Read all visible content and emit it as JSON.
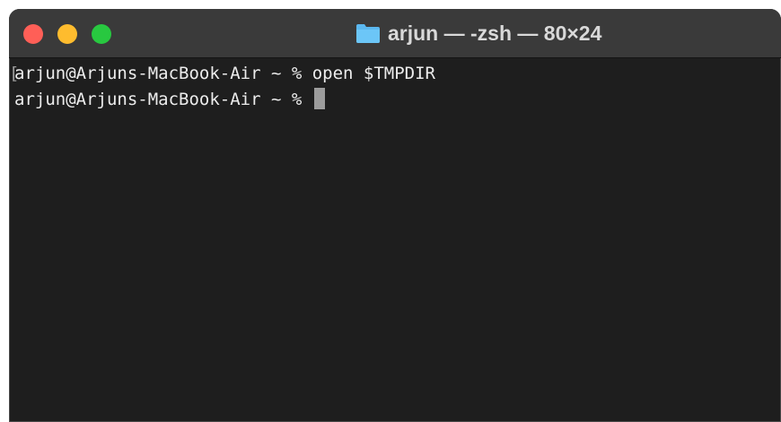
{
  "window": {
    "title": "arjun — -zsh — 80×24",
    "title_icon": "folder-icon",
    "colors": {
      "close": "#ff5f57",
      "minimize": "#febc2e",
      "zoom": "#28c840",
      "folder": "#5bb8f0"
    }
  },
  "terminal": {
    "marker": "[",
    "lines": [
      "arjun@Arjuns-MacBook-Air ~ % open $TMPDIR",
      "arjun@Arjuns-MacBook-Air ~ % "
    ]
  }
}
